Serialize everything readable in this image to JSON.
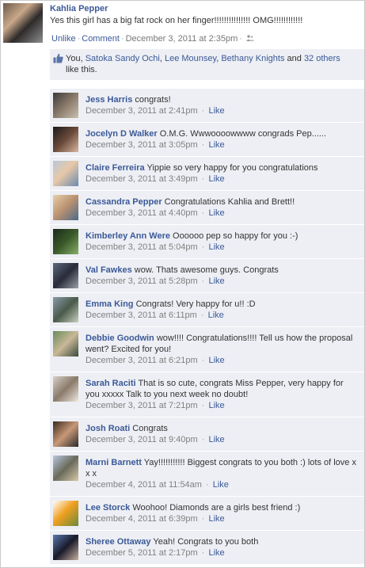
{
  "post": {
    "author": "Kahlia Pepper",
    "text": "Yes this girl has a big fat rock on her finger!!!!!!!!!!!!!!! OMG!!!!!!!!!!!!",
    "unlike_label": "Unlike",
    "comment_label": "Comment",
    "timestamp": "December 3, 2011 at 2:35pm",
    "privacy_icon": "friends-icon"
  },
  "likes": {
    "prefix": "You, ",
    "people": [
      "Satoka Sandy Ochi",
      "Lee Mounsey",
      "Bethany Knights"
    ],
    "sep1": ", ",
    "sep2": ", ",
    "and": " and ",
    "others": "32 others",
    "suffix": " like this.",
    "icon": "thumbs-up-icon"
  },
  "like_label": "Like",
  "comments": [
    {
      "author": "Jess Harris",
      "text": "congrats!",
      "time": "December 3, 2011 at 2:41pm"
    },
    {
      "author": "Jocelyn D Walker",
      "text": "O.M.G. Wwwoooowwww congrads Pep......",
      "time": "December 3, 2011 at 3:05pm"
    },
    {
      "author": "Claire Ferreira",
      "text": "Yippie so very happy for you congratulations",
      "time": "December 3, 2011 at 3:49pm"
    },
    {
      "author": "Cassandra Pepper",
      "text": "Congratulations Kahlia and Brett!!",
      "time": "December 3, 2011 at 4:40pm"
    },
    {
      "author": "Kimberley Ann Were",
      "text": "Oooooo pep so happy for you :-)",
      "time": "December 3, 2011 at 5:04pm"
    },
    {
      "author": "Val Fawkes",
      "text": "wow. Thats awesome guys. Congrats",
      "time": "December 3, 2011 at 5:28pm"
    },
    {
      "author": "Emma King",
      "text": "Congrats! Very happy for u!! :D",
      "time": "December 3, 2011 at 6:11pm"
    },
    {
      "author": "Debbie Goodwin",
      "text": "wow!!!! Congratulations!!!! Tell us how the proposal went? Excited for you!",
      "time": "December 3, 2011 at 6:21pm"
    },
    {
      "author": "Sarah Raciti",
      "text": "That is so cute, congrats Miss Pepper, very happy for you xxxxx Talk to you next week no doubt!",
      "time": "December 3, 2011 at 7:21pm"
    },
    {
      "author": "Josh Roati",
      "text": "Congrats",
      "time": "December 3, 2011 at 9:40pm"
    },
    {
      "author": "Marni Barnett",
      "text": "Yay!!!!!!!!!!! Biggest congrats to you both :) lots of love x x x",
      "time": "December 4, 2011 at 11:54am"
    },
    {
      "author": "Lee Storck",
      "text": "Woohoo! Diamonds are a girls best friend :)",
      "time": "December 4, 2011 at 6:39pm"
    },
    {
      "author": "Sheree Ottaway",
      "text": "Yeah! Congrats to you both",
      "time": "December 5, 2011 at 2:17pm"
    }
  ],
  "colors": {
    "link": "#3b5998",
    "comment_bg": "#edeff4",
    "meta": "#808080"
  }
}
